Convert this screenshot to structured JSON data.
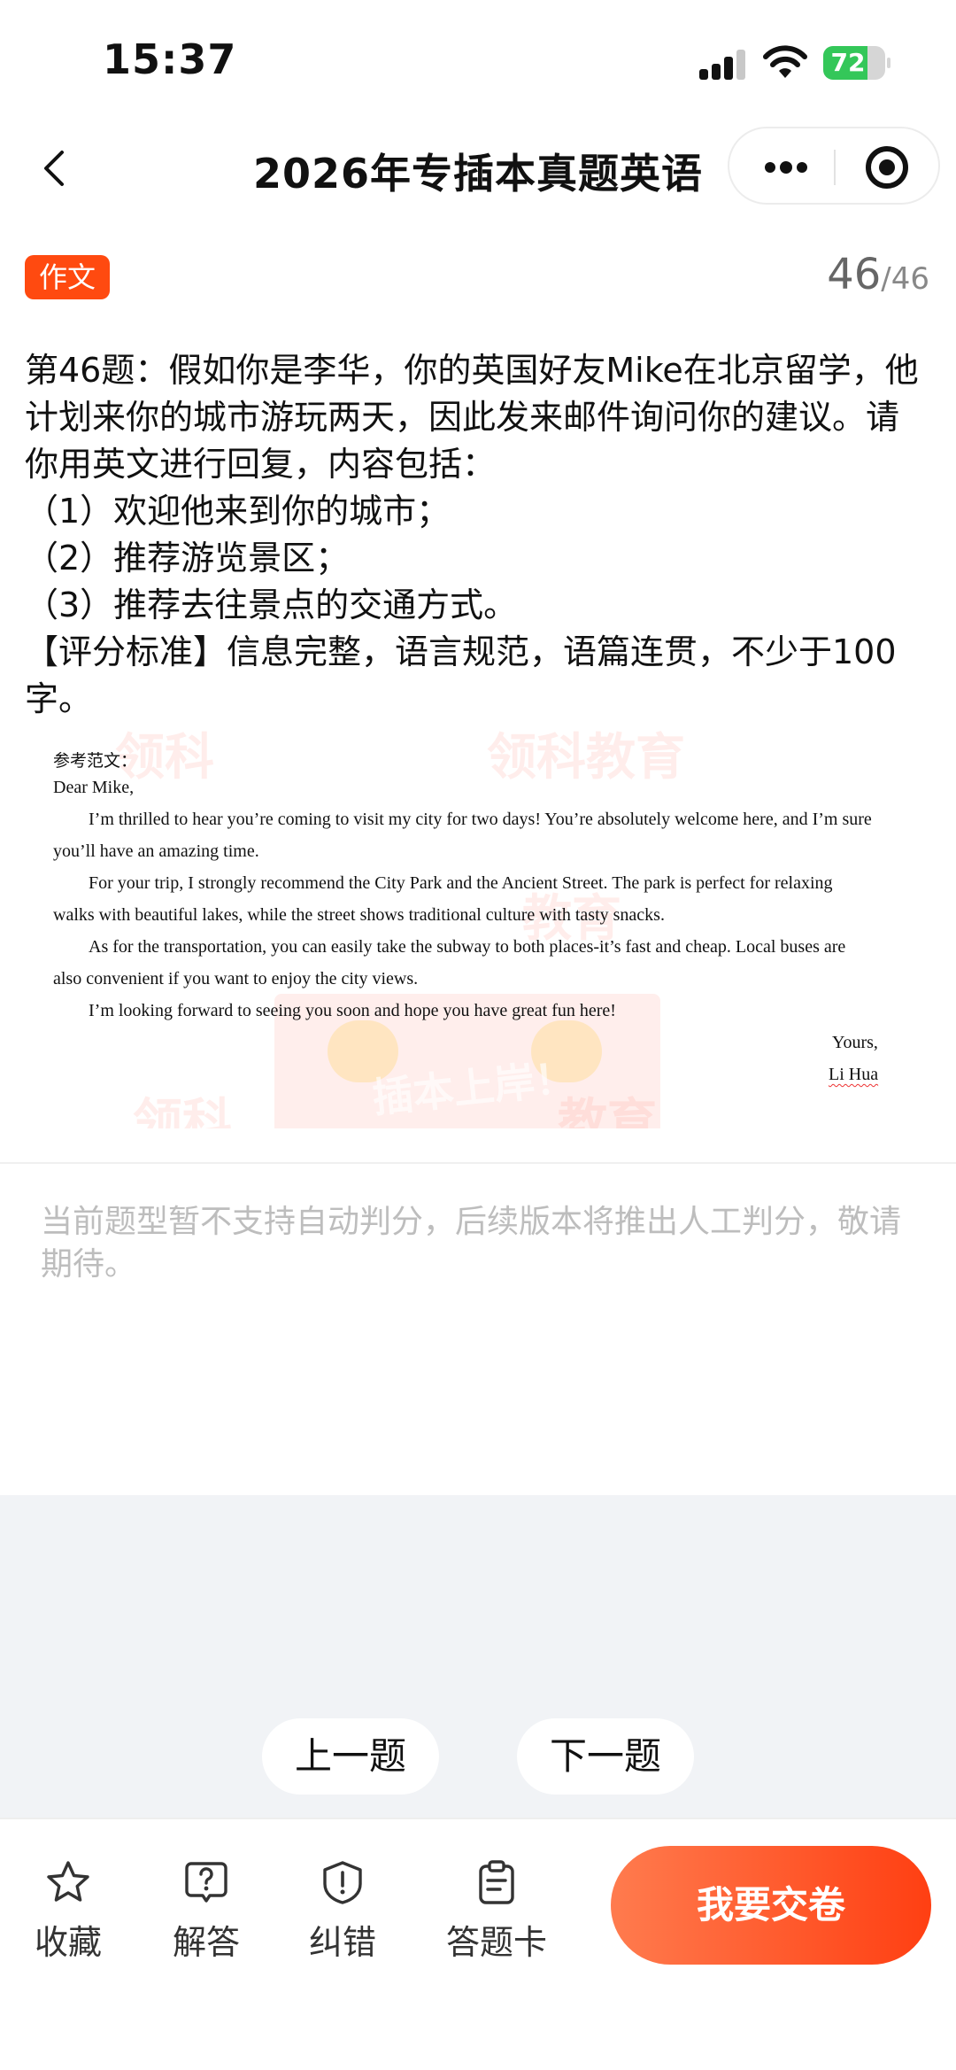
{
  "status_bar": {
    "time": "15:37",
    "battery": "72",
    "battery_level": 0.72
  },
  "nav": {
    "title": "2026年专插本真题英语"
  },
  "question_meta": {
    "type_label": "作文",
    "current": "46",
    "total": "/46"
  },
  "question": {
    "lines": [
      "第46题：假如你是李华，你的英国好友Mike在北京留学，他计划来你的城市游玩两天，因此发来邮件询问你的建议。请你用英文进行回复，内容包括：",
      "（1）欢迎他来到你的城市；",
      "（2）推荐游览景区；",
      "（3）推荐去往景点的交通方式。",
      "【评分标准】信息完整，语言规范，语篇连贯，不少于100字。"
    ]
  },
  "essay": {
    "heading": "参考范文：",
    "greeting": "Dear Mike,",
    "p1a": "I’m thrilled to hear you’re coming to visit my city for two days! You’re absolutely welcome here, and I’m sure",
    "p1b": "you’ll have an amazing time.",
    "p2a": "For your trip, I strongly recommend the City Park and the Ancient Street. The park is perfect for relaxing",
    "p2b": "walks with beautiful lakes, while the street shows traditional culture with tasty snacks.",
    "p3a": "As for the transportation, you can easily take the subway to both places-it’s fast and cheap. Local buses are",
    "p3b": "also convenient if you want to enjoy the city views.",
    "p4": "I’m looking forward to seeing you soon and hope you have great fun here!",
    "closing": "Yours,",
    "signature": "Li Hua",
    "watermark_text": "领科教育",
    "stamp_text": "插本上岸！"
  },
  "notice": "当前题型暂不支持自动判分，后续版本将推出人工判分，敬请期待。",
  "pager": {
    "prev": "上一题",
    "next": "下一题"
  },
  "toolbar": {
    "favorite": "收藏",
    "answer": "解答",
    "report": "纠错",
    "answer_card": "答题卡",
    "submit": "我要交卷"
  },
  "colors": {
    "accent": "#ff4a10",
    "gray_bg": "#f1f3f6"
  }
}
